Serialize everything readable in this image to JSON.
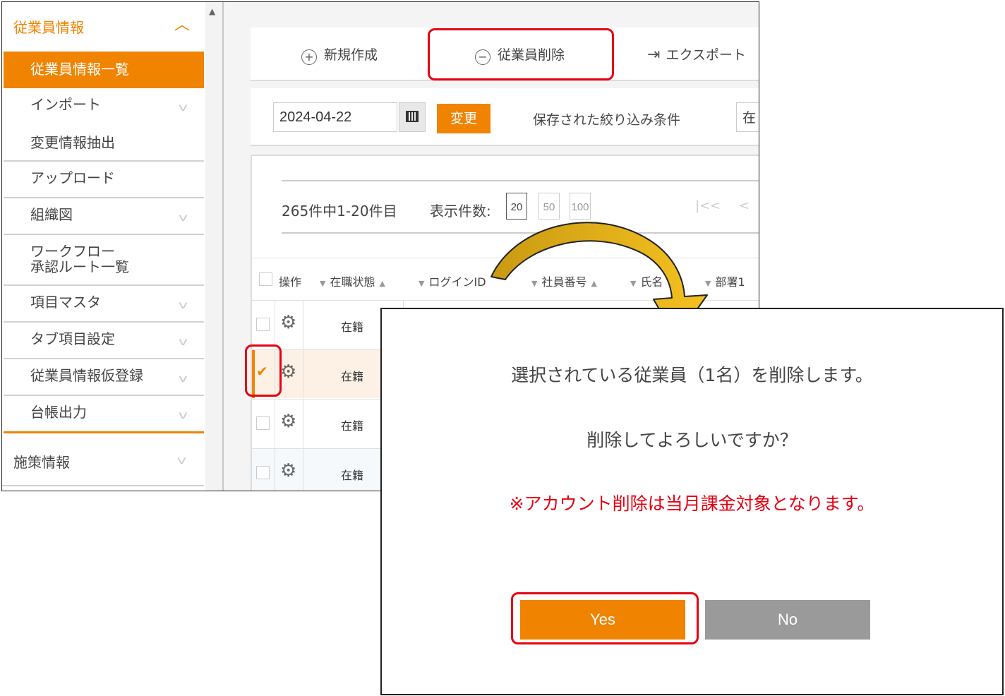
{
  "sidebar": {
    "header": "従業員情報",
    "items": [
      {
        "label": "従業員情報一覧",
        "active": true
      },
      {
        "label": "インポート"
      },
      {
        "label": "変更情報抽出"
      },
      {
        "label": "アップロード"
      },
      {
        "label": "組織図"
      },
      {
        "label_line1": "ワークフロー",
        "label_line2": "承認ルート一覧"
      },
      {
        "label": "項目マスタ"
      },
      {
        "label": "タブ項目設定"
      },
      {
        "label": "従業員情報仮登録"
      },
      {
        "label": "台帳出力"
      }
    ],
    "footer": "施策情報"
  },
  "toolbar": {
    "new": "新規作成",
    "delete": "従業員削除",
    "export": "エクスポート"
  },
  "filter": {
    "date": "2024-04-22",
    "change": "変更",
    "saved_label": "保存された絞り込み条件",
    "saved_value": "在"
  },
  "pagination": {
    "count": "265件中1-20件目",
    "per_page_label": "表示件数:",
    "options": [
      "20",
      "50",
      "100"
    ],
    "selected": "20"
  },
  "table": {
    "headers": {
      "op": "操作",
      "status": "在職状態",
      "login": "ログインID",
      "emp_no": "社員番号",
      "name": "氏名",
      "dept": "部署1"
    },
    "rows": [
      {
        "status": "在籍",
        "checked": false
      },
      {
        "status": "在籍",
        "checked": true
      },
      {
        "status": "在籍",
        "checked": false
      },
      {
        "status": "在籍",
        "checked": false
      }
    ]
  },
  "dialog": {
    "line1": "選択されている従業員（1名）を削除します。",
    "line2": "削除してよろしいですか？",
    "warning": "※アカウント削除は当月課金対象となります。",
    "yes": "Yes",
    "no": "No"
  },
  "colors": {
    "accent": "#f08300",
    "highlight": "#e60012",
    "no_button": "#9a9a9a"
  }
}
